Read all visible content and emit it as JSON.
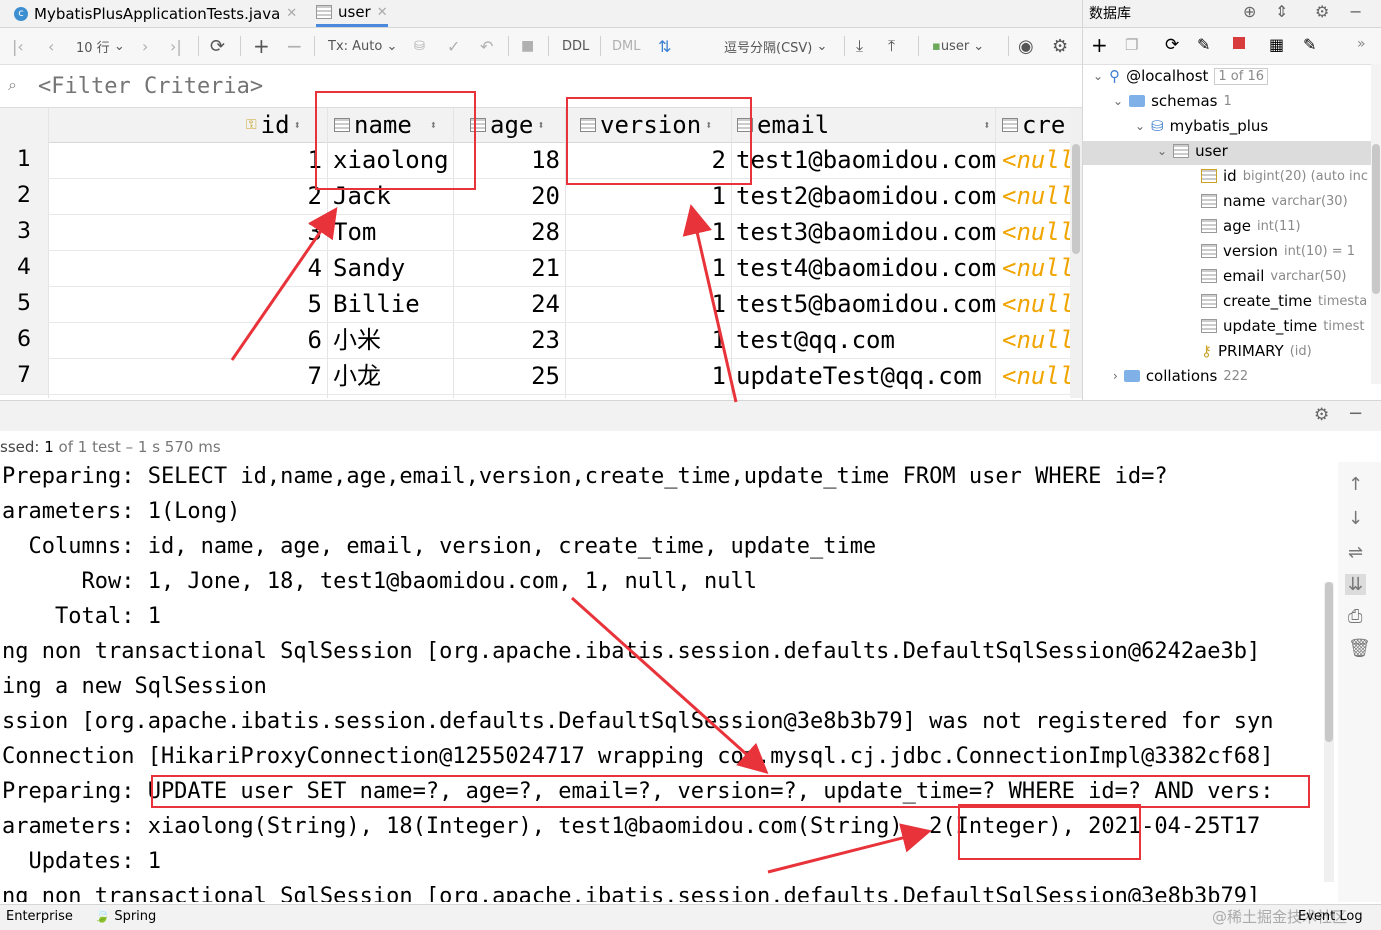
{
  "tabs": [
    {
      "label": "MybatisPlusApplicationTests.java",
      "icon": "java-class-icon"
    },
    {
      "label": "user",
      "icon": "table-icon"
    }
  ],
  "toolbar": {
    "rows_label": "10 行",
    "tx_label": "Tx: Auto",
    "ddl_label": "DDL",
    "dml_label": "DML",
    "export_label": "逗号分隔(CSV)",
    "schema_label": "user"
  },
  "filter": {
    "placeholder": "<Filter Criteria>"
  },
  "grid": {
    "columns": [
      "id",
      "name",
      "age",
      "version",
      "email",
      "cre"
    ],
    "rows": [
      {
        "num": "1",
        "id": "1",
        "name": "xiaolong",
        "age": "18",
        "version": "2",
        "email": "test1@baomidou.com",
        "create": "<null"
      },
      {
        "num": "2",
        "id": "2",
        "name": "Jack",
        "age": "20",
        "version": "1",
        "email": "test2@baomidou.com",
        "create": "<null"
      },
      {
        "num": "3",
        "id": "3",
        "name": "Tom",
        "age": "28",
        "version": "1",
        "email": "test3@baomidou.com",
        "create": "<null"
      },
      {
        "num": "4",
        "id": "4",
        "name": "Sandy",
        "age": "21",
        "version": "1",
        "email": "test4@baomidou.com",
        "create": "<null"
      },
      {
        "num": "5",
        "id": "5",
        "name": "Billie",
        "age": "24",
        "version": "1",
        "email": "test5@baomidou.com",
        "create": "<null"
      },
      {
        "num": "6",
        "id": "6",
        "name": "小米",
        "age": "23",
        "version": "1",
        "email": "test@qq.com",
        "create": "<null"
      },
      {
        "num": "7",
        "id": "7",
        "name": "小龙",
        "age": "25",
        "version": "1",
        "email": "updateTest@qq.com",
        "create": "<null"
      }
    ]
  },
  "db_panel": {
    "title": "数据库",
    "host": "@localhost",
    "host_badge": "1 of 16",
    "schemas": "schemas",
    "schemas_count": "1",
    "database": "mybatis_plus",
    "table": "user",
    "columns": [
      {
        "name": "id",
        "type": "bigint(20) (auto inc"
      },
      {
        "name": "name",
        "type": "varchar(30)"
      },
      {
        "name": "age",
        "type": "int(11)"
      },
      {
        "name": "version",
        "type": "int(10) = 1"
      },
      {
        "name": "email",
        "type": "varchar(50)"
      },
      {
        "name": "create_time",
        "type": "timesta"
      },
      {
        "name": "update_time",
        "type": "timest"
      }
    ],
    "primary": "PRIMARY",
    "primary_detail": "(id)",
    "collations": "collations",
    "collations_count": "222"
  },
  "test_status": {
    "prefix": "ssed: ",
    "count": "1",
    "rest": "of 1 test – 1 s 570 ms"
  },
  "console_lines": [
    "Preparing: SELECT id,name,age,email,version,create_time,update_time FROM user WHERE id=?",
    "arameters: 1(Long)",
    "  Columns: id, name, age, email, version, create_time, update_time",
    "      Row: 1, Jone, 18, test1@baomidou.com, 1, null, null",
    "    Total: 1",
    "ng non transactional SqlSession [org.apache.ibatis.session.defaults.DefaultSqlSession@6242ae3b]",
    "ing a new SqlSession",
    "ssion [org.apache.ibatis.session.defaults.DefaultSqlSession@3e8b3b79] was not registered for syn",
    "Connection [HikariProxyConnection@1255024717 wrapping com.mysql.cj.jdbc.ConnectionImpl@3382cf68]",
    "Preparing: UPDATE user SET name=?, age=?, email=?, version=?, update_time=? WHERE id=? AND vers:",
    "arameters: xiaolong(String), 18(Integer), test1@baomidou.com(String), 2(Integer), 2021-04-25T17",
    "  Updates: 1",
    "ng non transactional SqlSession [org.apache.ibatis.session.defaults.DefaultSqlSession@3e8b3b79]"
  ],
  "statusbar": {
    "enterprise": "Enterprise",
    "spring": "Spring",
    "event_log": "Event Log",
    "watermark": "@稀土掘金技术社区"
  },
  "colors": {
    "accent": "#4a89dc",
    "highlight": "#e8333a",
    "null": "#f0a500"
  }
}
